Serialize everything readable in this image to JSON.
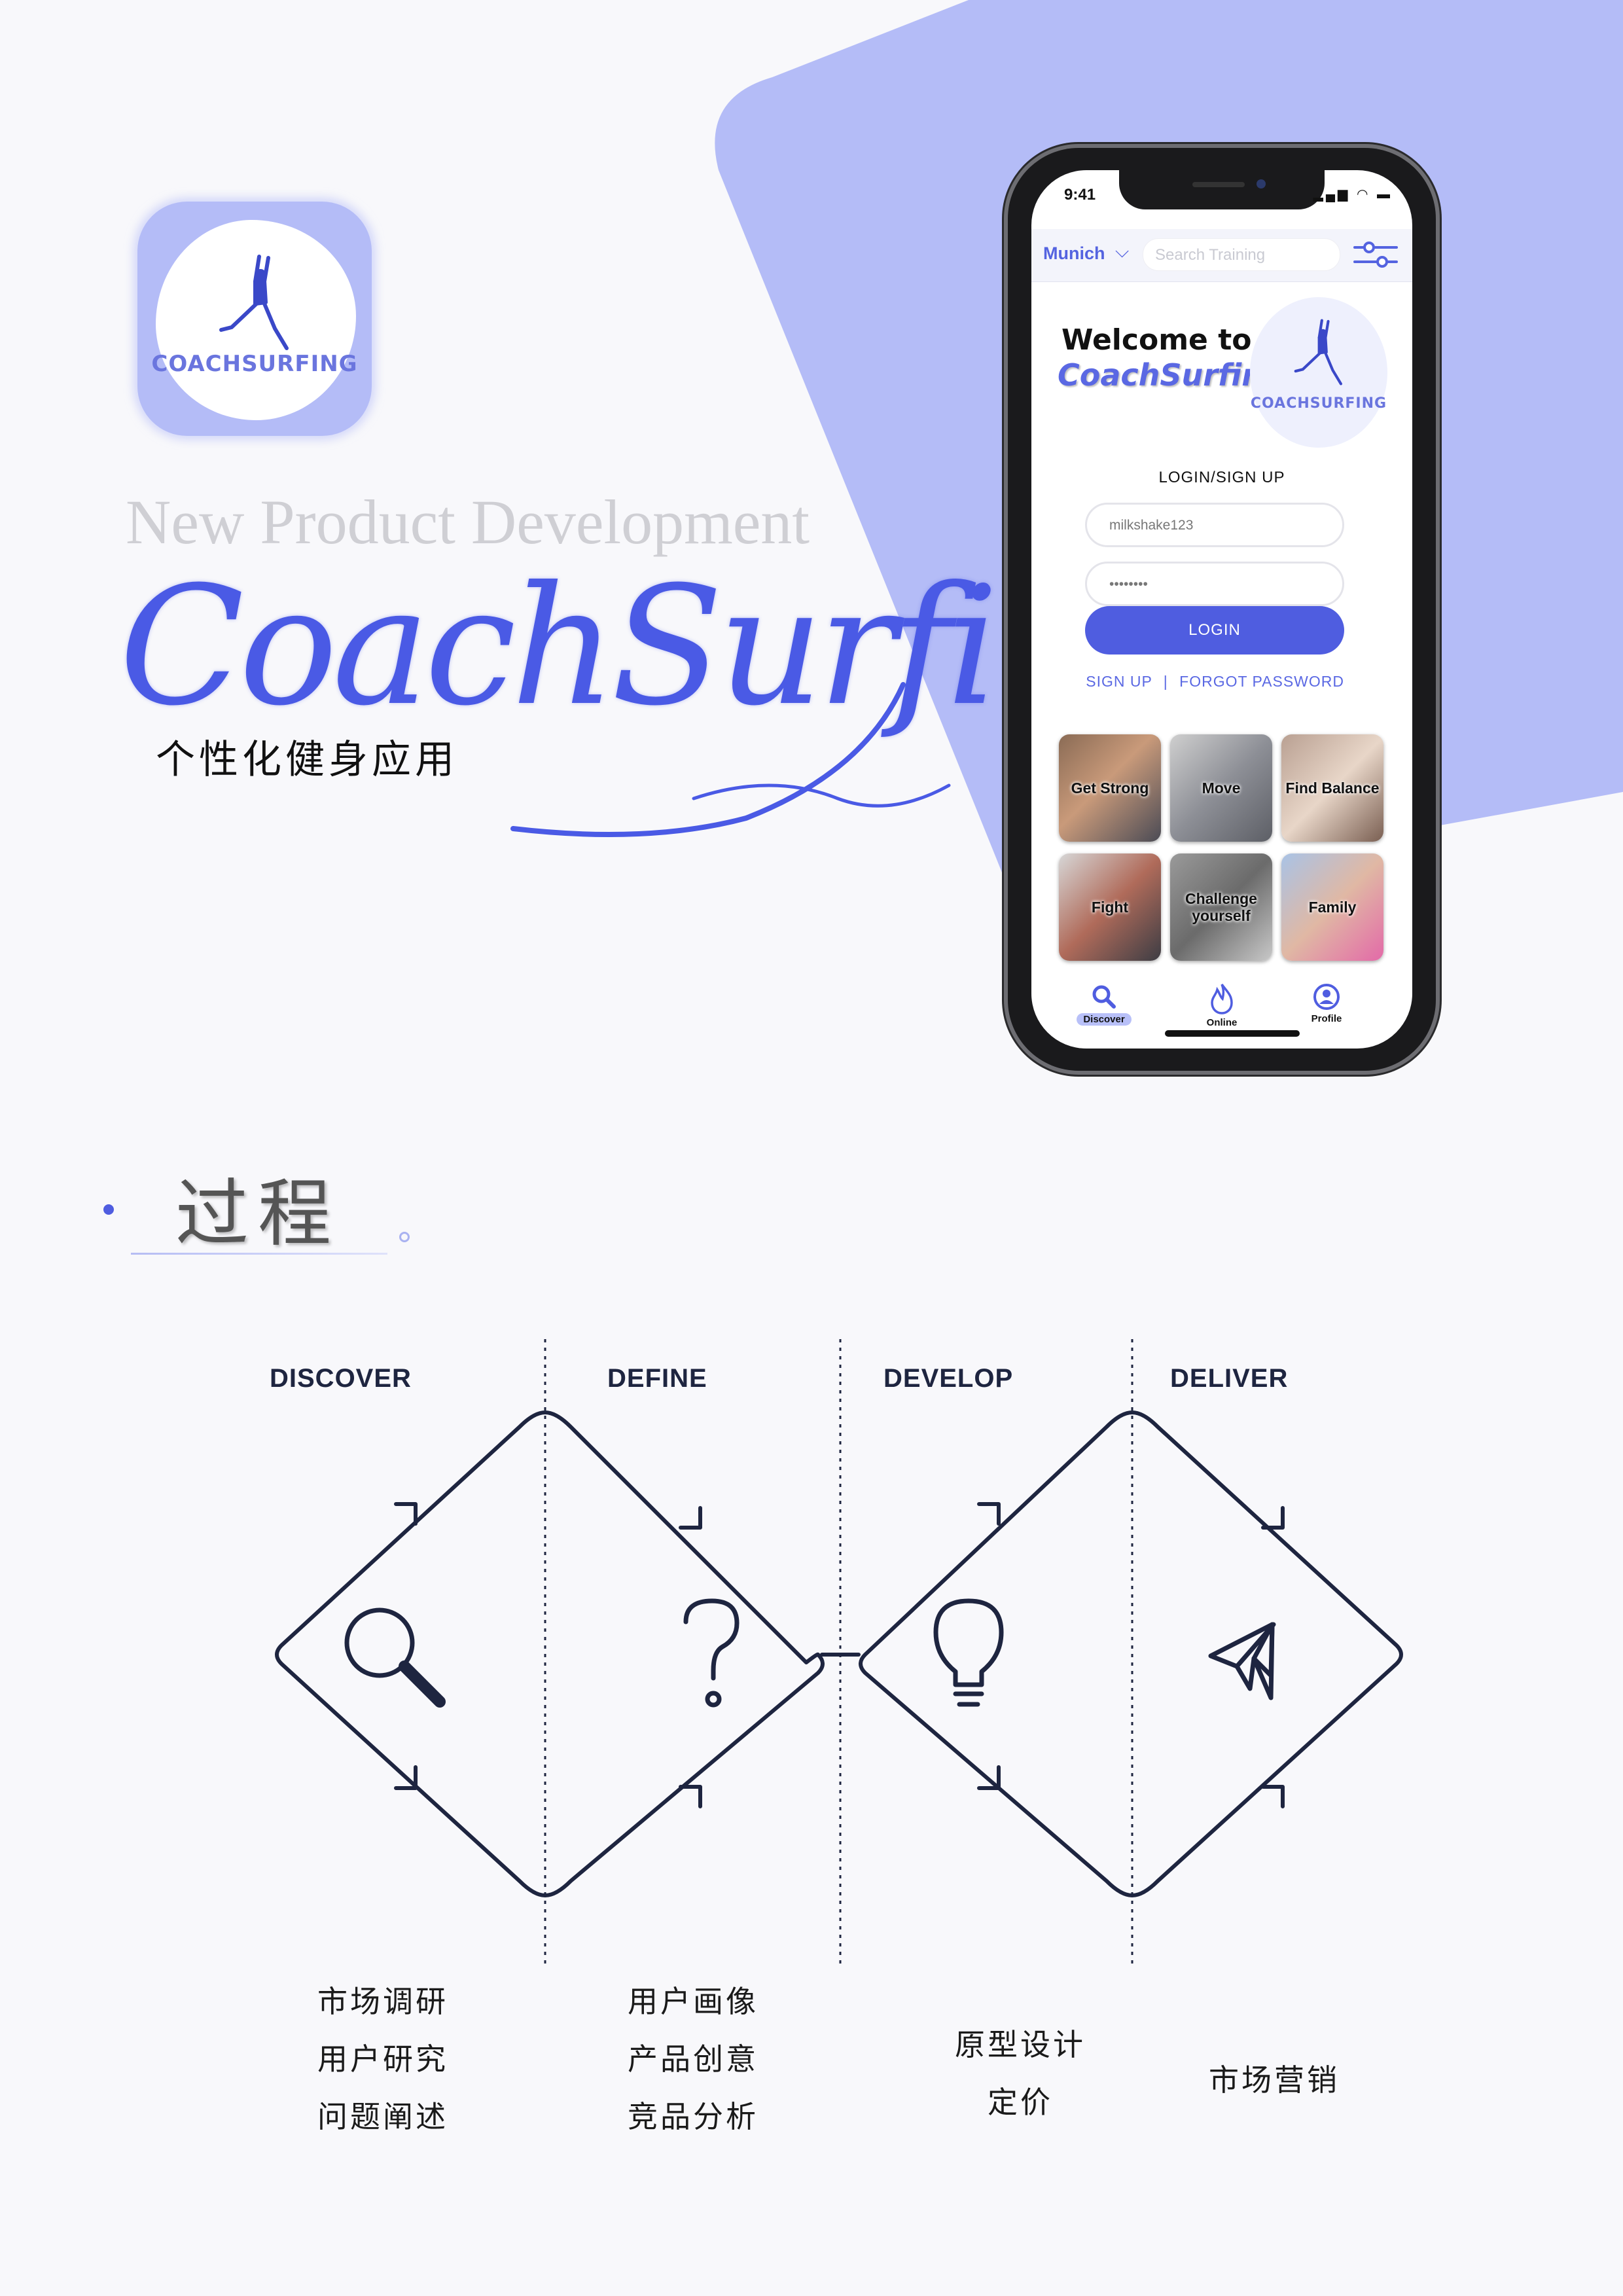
{
  "cover": {
    "npd_text": "New Product Development",
    "brand_script": "CoachSurfing",
    "subtitle": "个性化健身应用",
    "logo_text": "COACHSURFING"
  },
  "phone": {
    "status_time": "9:41",
    "city": "Munich",
    "search_placeholder": "Search Training",
    "welcome_line1": "Welcome to",
    "welcome_line2": "CoachSurfing",
    "logo_text": "COACHSURFING",
    "login_title": "LOGIN/SIGN UP",
    "username_value": "milkshake123",
    "password_value": "••••••••",
    "login_button": "LOGIN",
    "sign_up_link": "SIGN UP",
    "separator": "|",
    "forgot_link": "FORGOT PASSWORD",
    "categories": [
      {
        "label": "Get Strong"
      },
      {
        "label": "Move"
      },
      {
        "label": "Find Balance"
      },
      {
        "label": "Fight"
      },
      {
        "label": "Challenge yourself"
      },
      {
        "label": "Family"
      }
    ],
    "tabs": [
      {
        "label": "Discover",
        "icon": "search-icon",
        "active": true
      },
      {
        "label": "Online",
        "icon": "flame-icon",
        "active": false
      },
      {
        "label": "Profile",
        "icon": "profile-icon",
        "active": false
      }
    ]
  },
  "process": {
    "title": "过程",
    "phases": [
      {
        "label": "DISCOVER",
        "icon": "magnifier-icon",
        "tasks": [
          "市场调研",
          "用户研究",
          "问题阐述"
        ]
      },
      {
        "label": "DEFINE",
        "icon": "question-mark-icon",
        "tasks": [
          "用户画像",
          "产品创意",
          "竞品分析"
        ]
      },
      {
        "label": "DEVELOP",
        "icon": "lightbulb-icon",
        "tasks": [
          "原型设计",
          "定价"
        ]
      },
      {
        "label": "DELIVER",
        "icon": "paper-plane-icon",
        "tasks": [
          "市场营销"
        ]
      }
    ]
  },
  "colors": {
    "accent": "#4f5de0",
    "accent_light": "#b4bcf7",
    "diagram_stroke": "#1e2540",
    "background": "#f8f8fb"
  }
}
